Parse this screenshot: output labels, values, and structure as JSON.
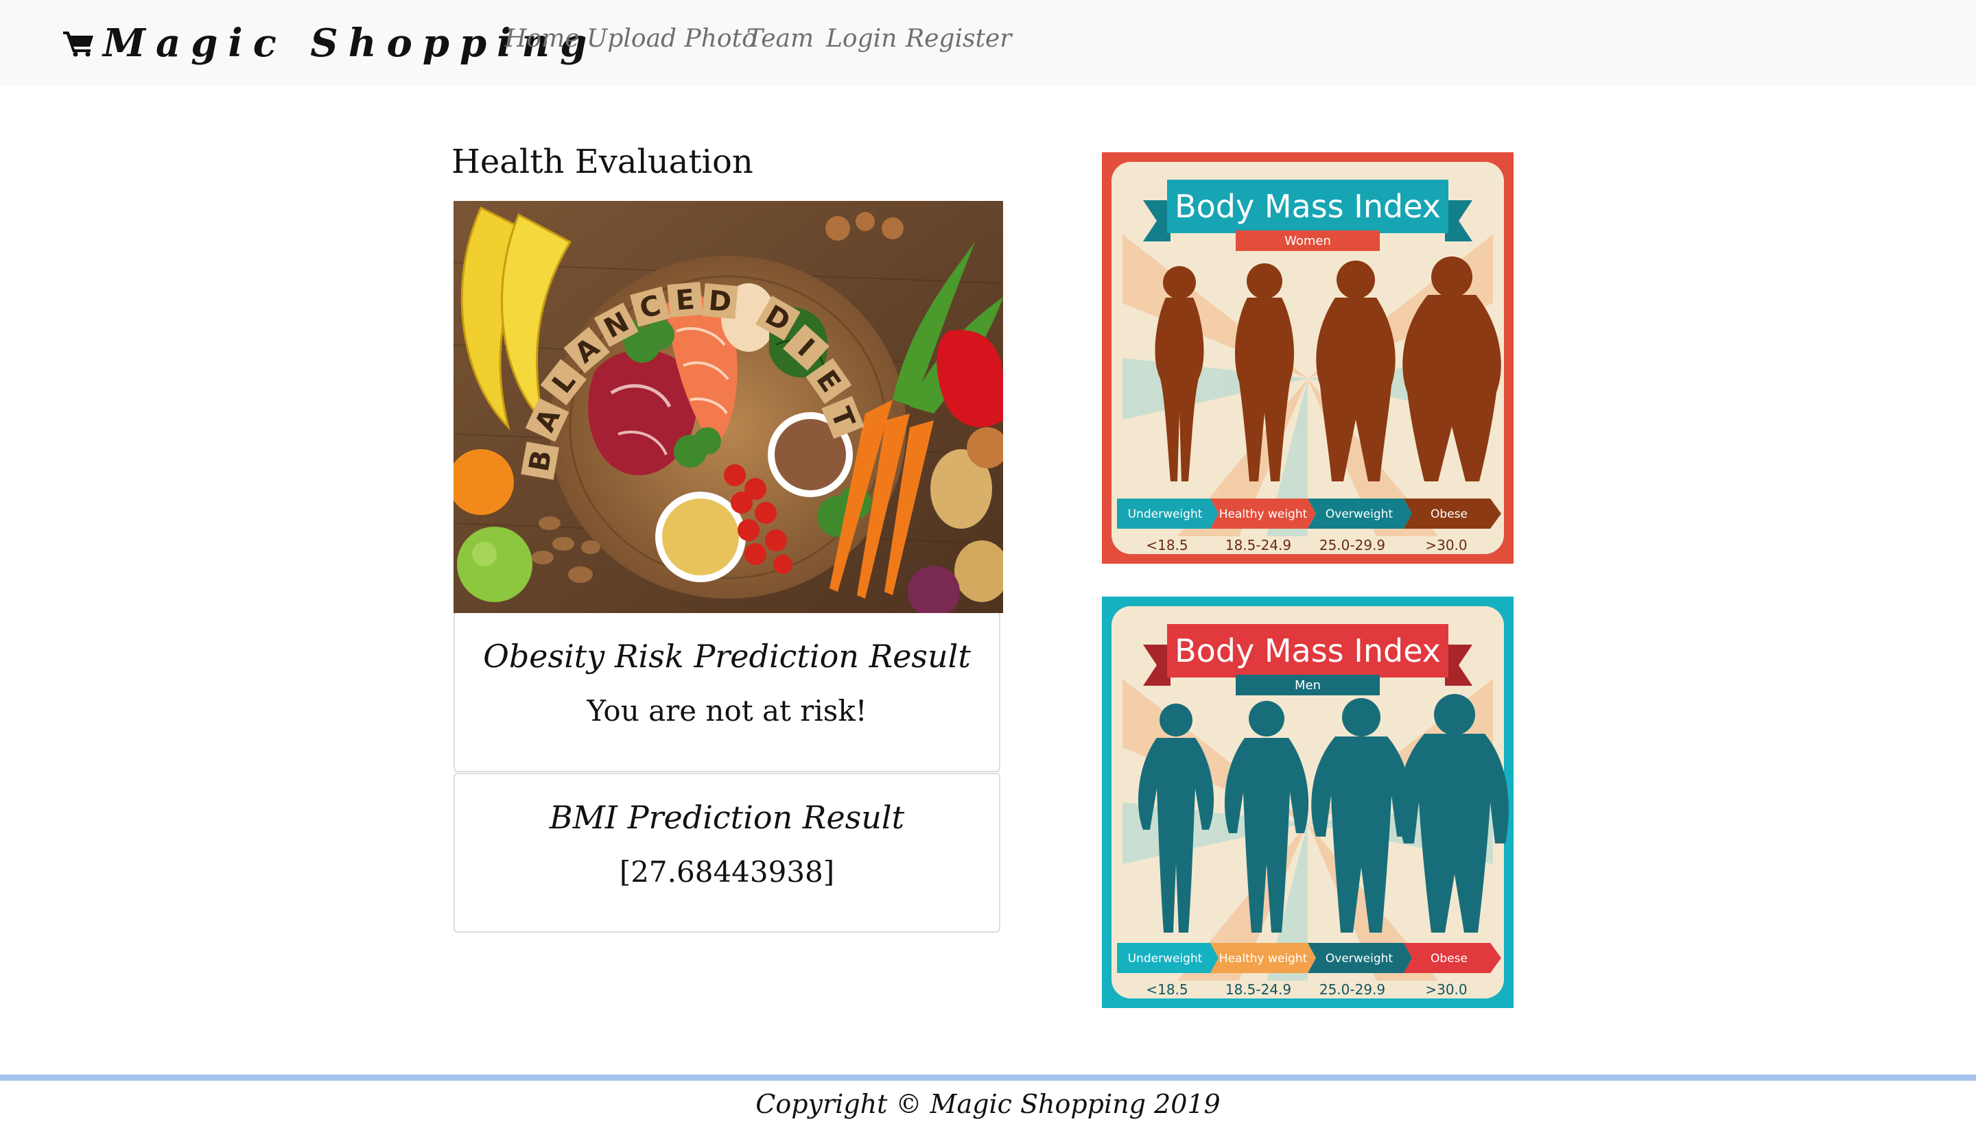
{
  "navbar": {
    "brand": "Magic Shopping",
    "brand_icon": "shopping-cart-icon",
    "links": [
      "Home",
      "Upload Photo",
      "Team",
      "Login",
      "Register"
    ]
  },
  "main": {
    "title": "Health Evaluation",
    "food_image": {
      "letters": [
        "B",
        "A",
        "L",
        "A",
        "N",
        "C",
        "E",
        "D",
        "D",
        "I",
        "E",
        "T"
      ]
    },
    "obesity_card": {
      "title": "Obesity Risk Prediction Result",
      "result": "You are not at risk!"
    },
    "bmi_card": {
      "title": "BMI Prediction Result",
      "result": "[27.68443938]"
    }
  },
  "posters": [
    {
      "title": "Body Mass Index",
      "subtitle": "Women",
      "frame_color": "#e24e3b",
      "figure_color": "#8b3a13",
      "categories": [
        "Underweight",
        "Healthy weight",
        "Overweight",
        "Obese"
      ],
      "ranges": [
        "<18.5",
        "18.5-24.9",
        "25.0-29.9",
        ">30.0"
      ]
    },
    {
      "title": "Body Mass Index",
      "subtitle": "Men",
      "frame_color": "#16b1c1",
      "figure_color": "#176e7a",
      "categories": [
        "Underweight",
        "Healthy weight",
        "Overweight",
        "Obese"
      ],
      "ranges": [
        "<18.5",
        "18.5-24.9",
        "25.0-29.9",
        ">30.0"
      ]
    }
  ],
  "footer": {
    "copyright": "Copyright © Magic Shopping 2019"
  }
}
